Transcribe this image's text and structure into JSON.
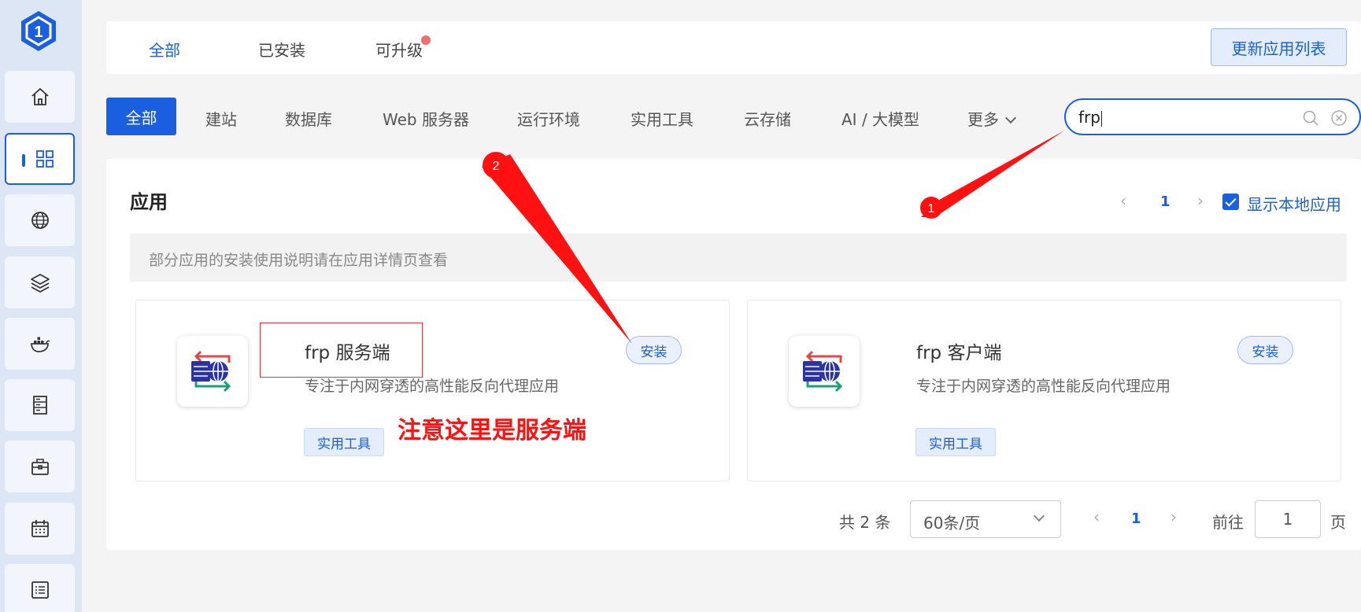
{
  "top_tabs": {
    "all": "全部",
    "installed": "已安装",
    "upgradable": "可升级"
  },
  "refresh_label": "更新应用列表",
  "categories": {
    "all": "全部",
    "site": "建站",
    "database": "数据库",
    "web_server": "Web 服务器",
    "runtime": "运行环境",
    "tools": "实用工具",
    "cloud_storage": "云存储",
    "ai": "AI / 大模型",
    "more": "更多"
  },
  "search": {
    "value": "frp"
  },
  "section_title": "应用",
  "pagination_top": {
    "current": "1"
  },
  "show_local_label": "显示本地应用",
  "notice": "部分应用的安装使用说明请在应用详情页查看",
  "apps": [
    {
      "name": "frp 服务端",
      "description": "专注于内网穿透的高性能反向代理应用",
      "install_label": "安装",
      "tag": "实用工具"
    },
    {
      "name": "frp 客户端",
      "description": "专注于内网穿透的高性能反向代理应用",
      "install_label": "安装",
      "tag": "实用工具"
    }
  ],
  "annotations": {
    "label_1": "1",
    "label_2": "2",
    "note": "注意这里是服务端"
  },
  "footer": {
    "total": "共 2 条",
    "page_size": "60条/页",
    "current": "1",
    "goto": "前往",
    "goto_value": "1",
    "page_suffix": "页"
  },
  "sidebar_icons": [
    "home-icon",
    "apps-icon",
    "globe-icon",
    "layers-icon",
    "docker-icon",
    "server-icon",
    "toolbox-icon",
    "calendar-icon",
    "list-icon"
  ],
  "colors": {
    "primary": "#1a5fe0",
    "annotation": "#ff1111",
    "sidebar": "#dde6f5"
  }
}
